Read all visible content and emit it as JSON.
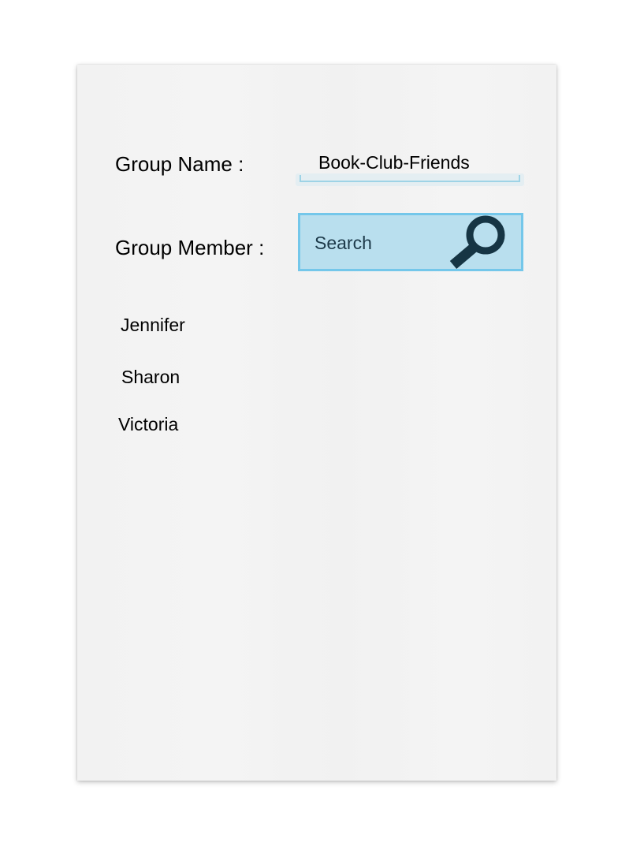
{
  "form": {
    "group_name_label": "Group Name :",
    "group_name_value": "Book-Club-Friends",
    "group_member_label": "Group Member :",
    "search": {
      "placeholder": "Search",
      "icon": "search-icon"
    }
  },
  "members": [
    "Jennifer",
    "Sharon",
    "Victoria"
  ],
  "colors": {
    "search_background": "#b9dfee",
    "search_border": "#74c7ea",
    "search_icon": "#163544",
    "field_underline": "#9ed3e6",
    "card_background": "#f2f2f2"
  }
}
